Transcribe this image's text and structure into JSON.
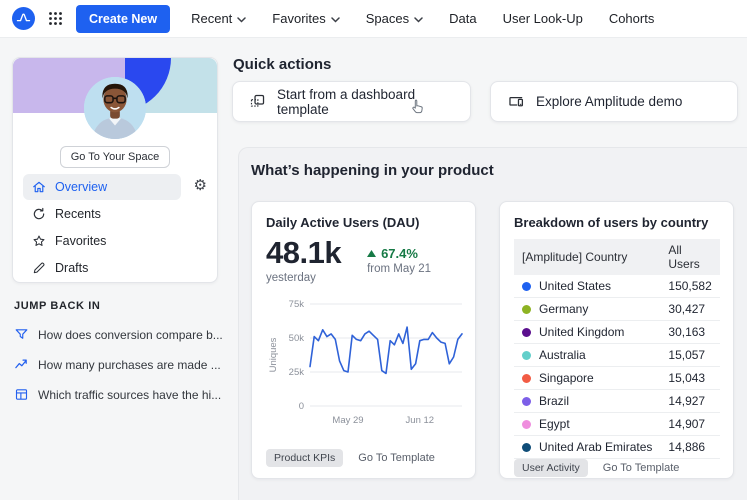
{
  "brand": {
    "accent_color": "#1e61f0"
  },
  "navbar": {
    "create_new_label": "Create New",
    "items": [
      {
        "label": "Recent",
        "has_dropdown": true
      },
      {
        "label": "Favorites",
        "has_dropdown": true
      },
      {
        "label": "Spaces",
        "has_dropdown": true
      },
      {
        "label": "Data",
        "has_dropdown": false
      },
      {
        "label": "User Look-Up",
        "has_dropdown": false
      },
      {
        "label": "Cohorts",
        "has_dropdown": false
      }
    ]
  },
  "sidebar": {
    "go_to_space_label": "Go To Your Space",
    "nav_items": [
      {
        "label": "Overview",
        "icon": "home-icon",
        "active": true
      },
      {
        "label": "Recents",
        "icon": "history-icon",
        "active": false
      },
      {
        "label": "Favorites",
        "icon": "star-icon",
        "active": false
      },
      {
        "label": "Drafts",
        "icon": "pencil-icon",
        "active": false
      }
    ],
    "jump_back_in": {
      "title": "JUMP BACK IN",
      "items": [
        {
          "label": "How does conversion compare b...",
          "icon": "funnel-icon"
        },
        {
          "label": "How many purchases are made ...",
          "icon": "line-chart-icon"
        },
        {
          "label": "Which traffic sources have the hi...",
          "icon": "table-icon"
        }
      ]
    }
  },
  "quick_actions": {
    "title": "Quick actions",
    "cards": [
      {
        "label": "Start from a dashboard template",
        "icon": "dashboard-template-icon"
      },
      {
        "label": "Explore Amplitude demo",
        "icon": "devices-icon"
      }
    ]
  },
  "product_section": {
    "title": "What’s happening in your product",
    "dau_card": {
      "title": "Daily Active Users (DAU)",
      "value": "48.1k",
      "value_caption": "yesterday",
      "delta": "67.4%",
      "delta_caption": "from May 21",
      "delta_color": "#177a46",
      "badge": "Product KPIs",
      "link": "Go To Template"
    },
    "country_card": {
      "title": "Breakdown of users by country",
      "columns": [
        "[Amplitude] Country",
        "All Users"
      ],
      "rows": [
        {
          "country": "United States",
          "value": "150,582",
          "color": "#1e61f0"
        },
        {
          "country": "Germany",
          "value": "30,427",
          "color": "#8db323"
        },
        {
          "country": "United Kingdom",
          "value": "30,163",
          "color": "#5b0f8e"
        },
        {
          "country": "Australia",
          "value": "15,057",
          "color": "#63cfca"
        },
        {
          "country": "Singapore",
          "value": "15,043",
          "color": "#f25c44"
        },
        {
          "country": "Brazil",
          "value": "14,927",
          "color": "#7d5fe8"
        },
        {
          "country": "Egypt",
          "value": "14,907",
          "color": "#ef8ede"
        },
        {
          "country": "United Arab Emirates",
          "value": "14,886",
          "color": "#0f4d78"
        }
      ],
      "badge": "User Activity",
      "link": "Go To Template"
    }
  },
  "chart_data": {
    "type": "line",
    "title": "Daily Active Users (DAU)",
    "ylabel": "Uniques",
    "unit": "thousands",
    "ylim": [
      0,
      75
    ],
    "grid": true,
    "line_color": "#2f62d8",
    "yticks": [
      {
        "label": "75k",
        "value": 75
      },
      {
        "label": "50k",
        "value": 50
      },
      {
        "label": "25k",
        "value": 25
      },
      {
        "label": "0",
        "value": 0
      }
    ],
    "xticks": [
      {
        "label": "May 29",
        "index": 9
      },
      {
        "label": "Jun 12",
        "index": 26
      }
    ],
    "values": [
      29,
      51,
      48,
      56,
      51,
      53,
      49,
      33,
      26,
      25,
      52,
      49,
      48,
      53,
      55,
      52,
      49,
      26,
      24,
      48,
      45,
      53,
      46,
      58,
      27,
      31,
      48,
      49,
      49,
      54,
      50,
      47,
      46,
      31,
      36,
      49,
      53
    ]
  }
}
